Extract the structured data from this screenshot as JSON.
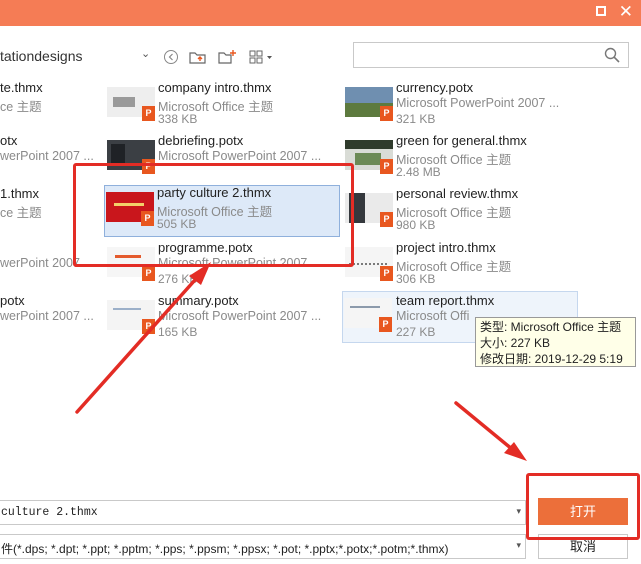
{
  "window": {
    "maximize_icon": "maximize-icon",
    "close_icon": "close-icon"
  },
  "toolbar": {
    "path": "tationdesigns",
    "back_icon": "back-icon",
    "up_folder_icon": "up-folder-icon",
    "new_folder_icon": "new-folder-icon",
    "view_mode_icon": "view-mode-icon",
    "search_placeholder": ""
  },
  "files": [
    {
      "name": "te.thmx",
      "type": "ce 主题",
      "size": "",
      "thumb": "none"
    },
    {
      "name": "otx",
      "type": "werPoint 2007 ...",
      "size": "",
      "thumb": "none"
    },
    {
      "name": "1.thmx",
      "type": "ce 主题",
      "size": "",
      "thumb": "none"
    },
    {
      "name": "",
      "type": "werPoint 2007 ...",
      "size": "",
      "thumb": "none"
    },
    {
      "name": "potx",
      "type": "werPoint 2007 ...",
      "size": "",
      "thumb": "none"
    },
    {
      "name": "company intro.thmx",
      "type": "Microsoft Office 主题",
      "size": "338 KB",
      "thumb": "gray"
    },
    {
      "name": "debriefing.potx",
      "type": "Microsoft PowerPoint 2007 ...",
      "size": "",
      "thumb": "dark"
    },
    {
      "name": "party culture 2.thmx",
      "type": "Microsoft Office 主题",
      "size": "505 KB",
      "thumb": "red"
    },
    {
      "name": "programme.potx",
      "type": "Microsoft PowerPoint 2007 ...",
      "size": "276 KB",
      "thumb": "light"
    },
    {
      "name": "summary.potx",
      "type": "Microsoft PowerPoint 2007 ...",
      "size": "165 KB",
      "thumb": "light"
    },
    {
      "name": "currency.potx",
      "type": "Microsoft PowerPoint 2007 ...",
      "size": "321 KB",
      "thumb": "photo"
    },
    {
      "name": "green for general.thmx",
      "type": "Microsoft Office 主题",
      "size": "2.48 MB",
      "thumb": "green"
    },
    {
      "name": "personal review.thmx",
      "type": "Microsoft Office 主题",
      "size": "980 KB",
      "thumb": "dark"
    },
    {
      "name": "project intro.thmx",
      "type": "Microsoft Office 主题",
      "size": "306 KB",
      "thumb": "light"
    },
    {
      "name": "team report.thmx",
      "type": "Microsoft Offi",
      "size": "227 KB",
      "thumb": "light"
    }
  ],
  "tooltip": {
    "type_line": "类型: Microsoft Office 主题",
    "size_line": "大小: 227 KB",
    "date_line": "修改日期: 2019-12-29 5:19"
  },
  "bottom": {
    "filename_value": "culture 2.thmx",
    "filter_value": "件(*.dps; *.dpt; *.ppt; *.pptm; *.pps; *.ppsm; *.ppsx; *.pot; *.pptx;*.potx;*.potm;*.thmx)",
    "open_label": "打开",
    "cancel_label": "取消"
  },
  "colors": {
    "title_bar": "#f57c55",
    "accent_button": "#ec6f3a",
    "annotation_red": "#e32c25",
    "selection": "#dde9f8"
  }
}
